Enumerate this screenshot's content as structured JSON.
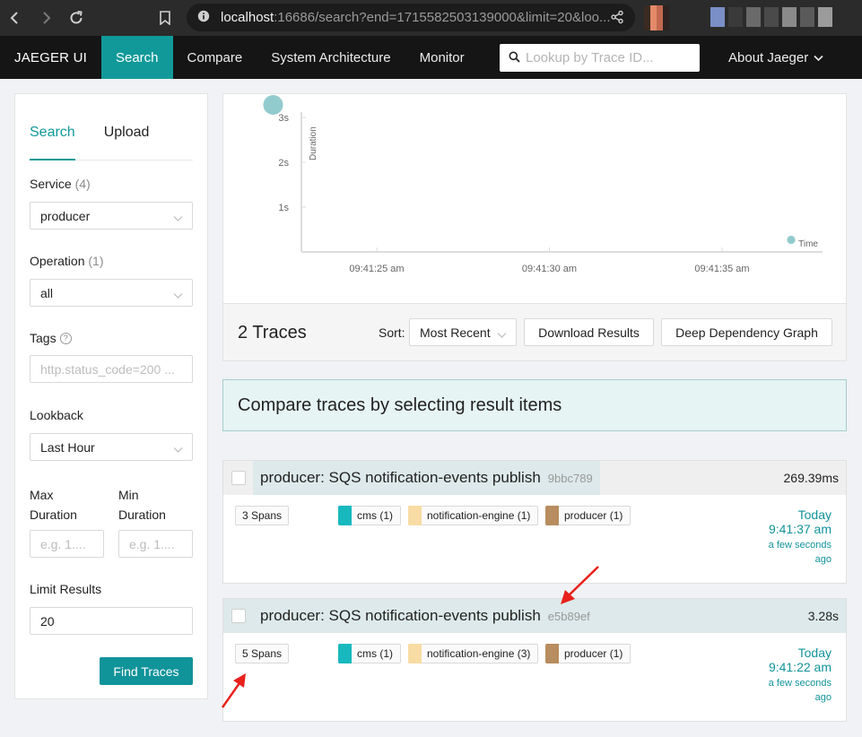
{
  "browser": {
    "url_host": "localhost",
    "url_rest": ":16686/search?end=1715582503139000&limit=20&loo..."
  },
  "nav": {
    "brand": "JAEGER UI",
    "items": [
      "Search",
      "Compare",
      "System Architecture",
      "Monitor"
    ],
    "lookup_placeholder": "Lookup by Trace ID...",
    "about": "About Jaeger"
  },
  "search_form": {
    "tabs": [
      "Search",
      "Upload"
    ],
    "service_label": "Service",
    "service_count": "(4)",
    "service_value": "producer",
    "operation_label": "Operation",
    "operation_count": "(1)",
    "operation_value": "all",
    "tags_label": "Tags",
    "tags_placeholder": "http.status_code=200 ...",
    "lookback_label": "Lookback",
    "lookback_value": "Last Hour",
    "max_duration_label_1": "Max",
    "max_duration_label_2": "Duration",
    "min_duration_label_1": "Min",
    "min_duration_label_2": "Duration",
    "duration_placeholder": "e.g. 1....",
    "limit_label": "Limit Results",
    "limit_value": "20",
    "find_button": "Find Traces"
  },
  "chart_data": {
    "type": "scatter",
    "ylabel": "Duration",
    "xlabel": "Time",
    "y_ticks": [
      "1s",
      "2s",
      "3s"
    ],
    "x_ticks": [
      "09:41:25 am",
      "09:41:30 am",
      "09:41:35 am"
    ],
    "points": [
      {
        "time": "09:41:22 am",
        "duration_s": 3.28
      },
      {
        "time": "09:41:37 am",
        "duration_s": 0.27
      }
    ],
    "point_color": "#8cc8cb"
  },
  "results": {
    "count_label": "2 Traces",
    "sort_label": "Sort:",
    "sort_value": "Most Recent",
    "download_button": "Download Results",
    "ddg_button": "Deep Dependency Graph",
    "compare_banner": "Compare traces by selecting result items"
  },
  "traces": [
    {
      "title": "producer: SQS notification-events publish",
      "id": "9bbc789",
      "duration": "269.39ms",
      "spans": "3 Spans",
      "services": [
        {
          "label": "cms (1)",
          "color": "#17b8be"
        },
        {
          "label": "notification-engine (1)",
          "color": "#f8dca4"
        },
        {
          "label": "producer (1)",
          "color": "#b88d5f"
        }
      ],
      "day": "Today",
      "time": "9:41:37 am",
      "relative": "a few seconds ago"
    },
    {
      "title": "producer: SQS notification-events publish",
      "id": "e5b89ef",
      "duration": "3.28s",
      "spans": "5 Spans",
      "services": [
        {
          "label": "cms (1)",
          "color": "#17b8be"
        },
        {
          "label": "notification-engine (3)",
          "color": "#f8dca4"
        },
        {
          "label": "producer (1)",
          "color": "#b88d5f"
        }
      ],
      "day": "Today",
      "time": "9:41:22 am",
      "relative": "a few seconds ago"
    }
  ]
}
